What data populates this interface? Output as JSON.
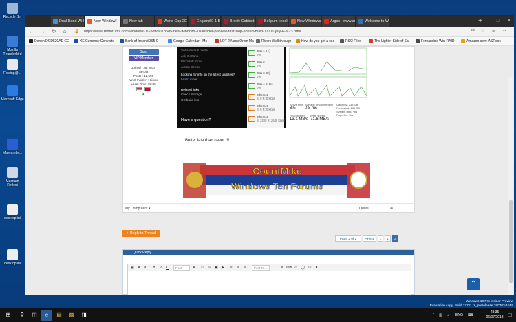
{
  "desktop": {
    "icons": [
      {
        "label": "Recycle Bin",
        "color": "#9fb7d6"
      },
      {
        "label": "Mozilla Thunderbird",
        "color": "#3b7bd6"
      },
      {
        "label": "Folding@...",
        "color": "#e9e9e9"
      },
      {
        "label": "Microsoft Edge",
        "color": "#2c7be5"
      },
      {
        "label": "Malwareby...",
        "color": "#2b5dd4"
      },
      {
        "label": "Macrium Reflect",
        "color": "#cfd8e3"
      },
      {
        "label": "desktop.ini",
        "color": "#eeeeee"
      },
      {
        "label": "desktop.ini",
        "color": "#eeeeee"
      }
    ]
  },
  "browser": {
    "tabs": [
      {
        "label": "Dual-Band Wi-Fi",
        "color": "#4a8fd8",
        "active": false
      },
      {
        "label": "New Window",
        "color": "#e25b2a",
        "active": true
      },
      {
        "label": "New tab",
        "color": "#777777",
        "active": false
      },
      {
        "label": "World Cup 2018",
        "color": "#e63b2e",
        "active": false
      },
      {
        "label": "England 0-1 Belg",
        "color": "#b0192d",
        "active": false
      },
      {
        "label": "Brexit: Cabinet a",
        "color": "#b0192d",
        "active": false
      },
      {
        "label": "Belgium knock o",
        "color": "#b0192d",
        "active": false
      },
      {
        "label": "New Windows 1",
        "color": "#e25b2a",
        "active": false
      },
      {
        "label": "Argos - www.arg",
        "color": "#e2231a",
        "active": false
      },
      {
        "label": "Welcome to Win",
        "color": "#2f6fc7",
        "active": false
      }
    ],
    "address": "https://www.tenforums.com/windows-10-news/113585-new-windows-10-insider-preview-fast-skip-ahead-build-17711-july-6-a-23.html",
    "favorites": [
      {
        "label": "Denon DCD520AE CE",
        "color": "#222222"
      },
      {
        "label": "XE Currency Converte",
        "color": "#1c4fa0"
      },
      {
        "label": "Bank of Ireland 365 C",
        "color": "#1b4f9c"
      },
      {
        "label": "Google Calendar - Mc",
        "color": "#4285f4"
      },
      {
        "label": "LOT 2 Naca Orion Ma",
        "color": "#c0392b"
      },
      {
        "label": "Rivers Walkthrough",
        "color": "#6a6a6a"
      },
      {
        "label": "How do you get a coo",
        "color": "#d68a1a"
      },
      {
        "label": "PS/2 Files",
        "color": "#555555"
      },
      {
        "label": "The Lighter Side of Sa",
        "color": "#d63a2a"
      },
      {
        "label": "Fernando's Win-RAID",
        "color": "#4a4a4a"
      },
      {
        "label": "Amazon.com: ASRock",
        "color": "#e5a11a"
      }
    ]
  },
  "post": {
    "user": {
      "rank1": "Guru",
      "rank2": "VIP Member",
      "joined": "Joined : Jul 2014",
      "location": "Serbia",
      "posts": "Posts : 12,550",
      "os": "W10 Insider + Linux",
      "localtime": "Local Time: 03:35"
    },
    "screenshot": {
      "menu_items": [
        "Set a default printer",
        "Ask Cortana",
        "Microsoft Store",
        "Action Center"
      ],
      "updates_prompt": "Looking for info on the latest updates?",
      "updates_link": "Learn more",
      "related": "Related links",
      "related_items": [
        "Check Storage",
        "OS build info"
      ],
      "question": "Have a question?",
      "disks": [
        {
          "name": "Disk 1 (H:)",
          "value": "0%",
          "type": "disk"
        },
        {
          "name": "Disk 2",
          "value": "0%",
          "type": "disk"
        },
        {
          "name": "Disk 3 (E:)",
          "value": "0%",
          "type": "disk"
        },
        {
          "name": "Disk 4 (I: G:)",
          "value": "0%",
          "type": "disk"
        },
        {
          "name": "Ethernet",
          "value": "S: 0 R: 0 Kbps",
          "type": "net"
        },
        {
          "name": "Ethernet",
          "value": "S: 0 R: 0 Kbps",
          "type": "net"
        },
        {
          "name": "Ethernet",
          "value": "S: 3228 R: 2640 Kbps",
          "type": "net"
        }
      ],
      "active_time_label": "Active time",
      "active_time": "8%",
      "response_label": "Average response time",
      "response": "0.8 ms",
      "read_label": "Read speed",
      "read": "13.1 MB/s",
      "write_label": "Write speed",
      "write": "71.6 MB/s",
      "capacity_label": "Capacity:",
      "capacity": "233 GB",
      "formatted_label": "Formatted:",
      "formatted": "233 GB",
      "system_disk_label": "System disk:",
      "system_disk": "Yes",
      "page_file_label": "Page file:",
      "page_file": "Yes"
    },
    "text": "Better late than never !!!",
    "banner": "CountMike Windows Ten Forums",
    "banner_line1": "CountMike",
    "banner_line2": "Windows Ten Forums",
    "my_computers": "My Computers",
    "quote": "Quote"
  },
  "actions": {
    "reply": "+ Reply to Thread",
    "page_of": "Page 2 of 2",
    "first": "«First",
    "prev": "<",
    "pages": [
      "1",
      "2"
    ]
  },
  "quick_reply": {
    "title": "Quick Reply",
    "font_placeholder": "Font",
    "size_placeholder": "Size",
    "post_placeholder": "Post Te..."
  },
  "watermark": {
    "line1": "Windows 10 Pro Insider Preview",
    "line2": "Evaluation copy. Build 17711.rs_prerelease.180703-1539"
  },
  "taskbar": {
    "lang": "ENG",
    "time": "23:35",
    "date": "06/07/2018"
  }
}
